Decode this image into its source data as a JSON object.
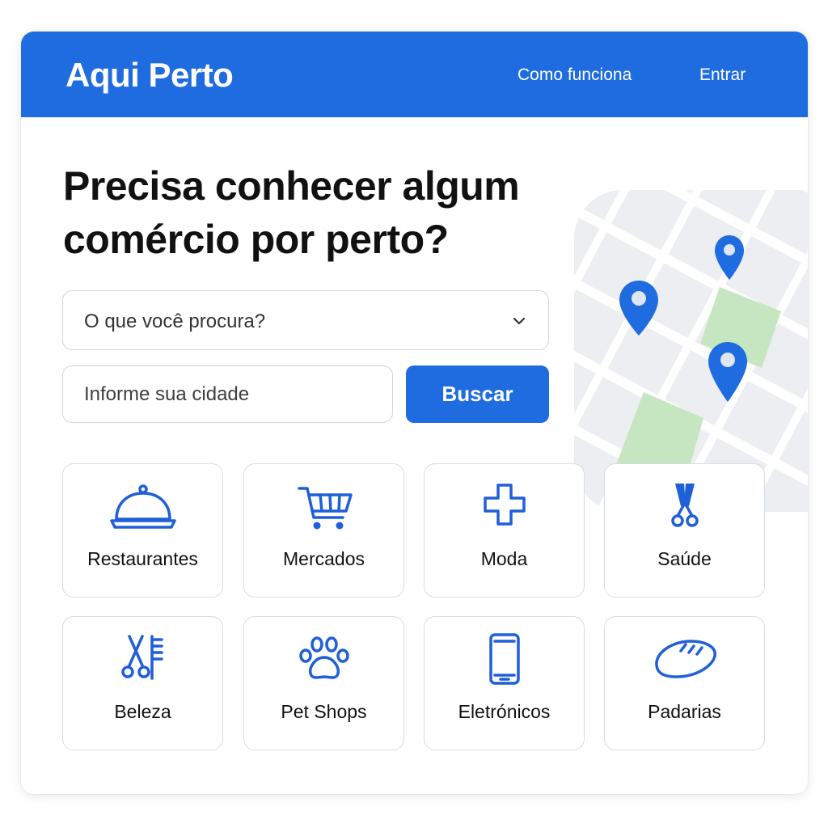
{
  "header": {
    "logo": "Aqui Perto",
    "nav": [
      {
        "label": "Como funciona"
      },
      {
        "label": "Entrar"
      }
    ],
    "bg_color": "#1f6ce0"
  },
  "hero": {
    "title_line1": "Precisa conhecer algum",
    "title_line2": "comércio por perto?"
  },
  "search": {
    "category_select": {
      "value": "O que você procura?",
      "icon": "chevron-down-icon"
    },
    "city_input": {
      "placeholder": "Informe sua cidade",
      "value": ""
    },
    "button_label": "Buscar"
  },
  "categories": [
    {
      "label": "Restaurantes",
      "icon": "cloche-icon"
    },
    {
      "label": "Mercados",
      "icon": "shopping-cart-icon"
    },
    {
      "label": "Moda",
      "icon": "plus-cross-icon"
    },
    {
      "label": "Saúde",
      "icon": "scissors-icon"
    },
    {
      "label": "Beleza",
      "icon": "scissors-comb-icon"
    },
    {
      "label": "Pet Shops",
      "icon": "paw-icon"
    },
    {
      "label": "Eletrónicos",
      "icon": "tablet-icon"
    },
    {
      "label": "Padarias",
      "icon": "bread-icon"
    }
  ],
  "map": {
    "pins": 3,
    "pin_color": "#1f6ce0",
    "park_color": "#c5e6c0",
    "road_color": "#ffffff",
    "block_color": "#eceef1"
  },
  "colors": {
    "accent": "#1f6ce0",
    "icon": "#1f5fd8",
    "border": "#d5dce8"
  }
}
